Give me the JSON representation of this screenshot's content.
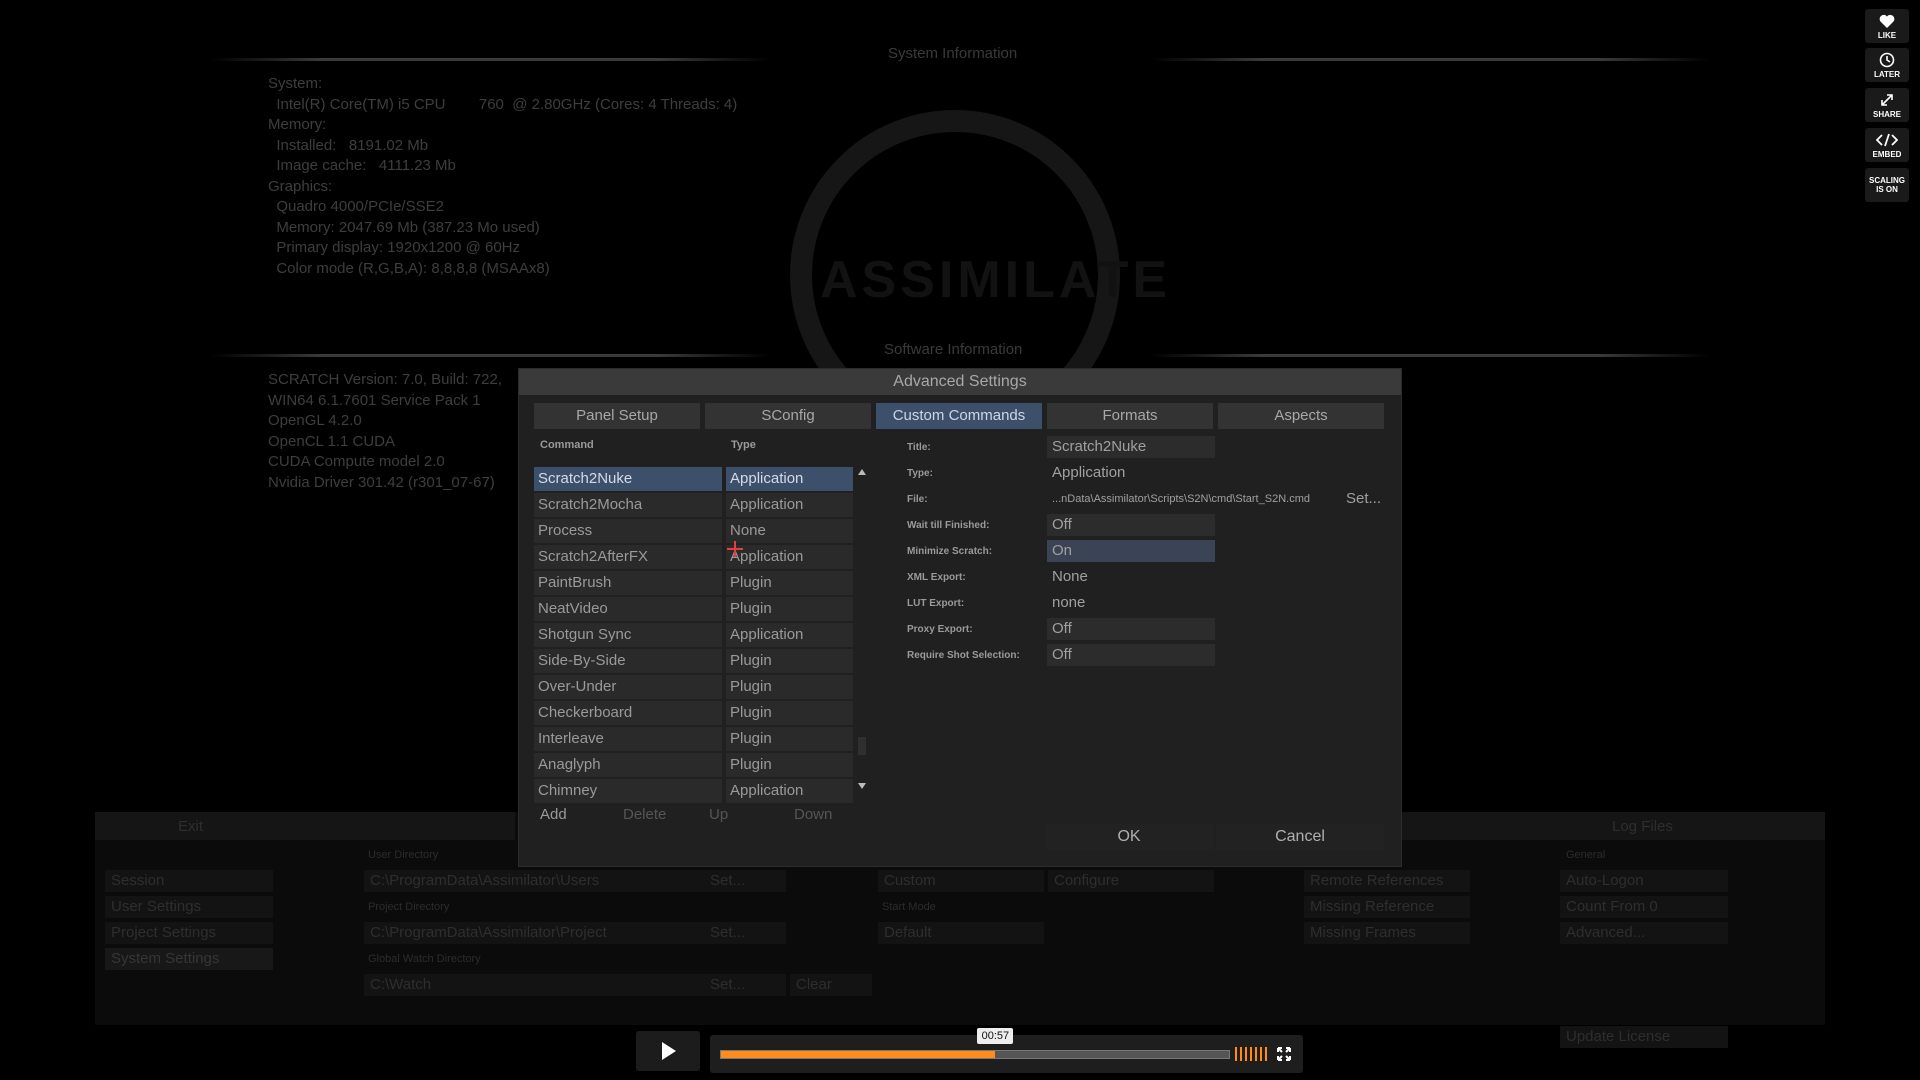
{
  "background": {
    "system_title": "System Information",
    "system_lines": [
      "System:",
      "  Intel(R) Core(TM) i5 CPU        760  @ 2.80GHz (Cores: 4 Threads: 4)",
      "Memory:",
      "  Installed:   8191.02 Mb",
      "  Image cache:   4111.23 Mb",
      "Graphics:",
      "  Quadro 4000/PCIe/SSE2",
      "  Memory: 2047.69 Mb (387.23 Mo used)",
      "  Primary display: 1920x1200 @ 60Hz",
      "  Color mode (R,G,B,A): 8,8,8,8 (MSAAx8)"
    ],
    "software_title": "Software Information",
    "software_lines": [
      "SCRATCH Version: 7.0, Build: 722,",
      "WIN64 6.1.7601 Service Pack 1",
      "OpenGL 4.2.0",
      "OpenCL 1.1 CUDA",
      "CUDA Compute model 2.0",
      "Nvidia Driver 301.42 (r301_07-67)"
    ],
    "logo": "ASSIMILATE",
    "bottom_left_header": "Exit",
    "bottom_right_header": "Log Files",
    "sidebar_items": [
      "Session",
      "User Settings",
      "Project Settings",
      "System Settings"
    ],
    "dir_labels": [
      "User Directory",
      "Project Directory",
      "Global Watch Directory"
    ],
    "dir_values": [
      "C:\\ProgramData\\Assimilator\\Users",
      "C:\\ProgramData\\Assimilator\\Project",
      "C:\\Watch"
    ],
    "set_label": "Set...",
    "clear_label": "Clear",
    "middle_buttons": [
      "Custom",
      "Configure"
    ],
    "middle_label": "Start Mode",
    "middle_button2": "Default",
    "reference_buttons": [
      "Remote References",
      "Missing Reference",
      "Missing Frames"
    ],
    "general_label": "General",
    "general_buttons": [
      "Auto-Logon",
      "Count From 0",
      "Advanced..."
    ],
    "update_license": "Update License"
  },
  "dialog": {
    "title": "Advanced Settings",
    "tabs": [
      "Panel Setup",
      "SConfig",
      "Custom Commands",
      "Formats",
      "Aspects"
    ],
    "active_tab": "Custom Commands",
    "col_command": "Command",
    "col_type": "Type",
    "commands": [
      {
        "name": "Scratch2Nuke",
        "type": "Application"
      },
      {
        "name": "Scratch2Mocha",
        "type": "Application"
      },
      {
        "name": "Process",
        "type": "None"
      },
      {
        "name": "Scratch2AfterFX",
        "type": "Application"
      },
      {
        "name": "PaintBrush",
        "type": "Plugin"
      },
      {
        "name": "NeatVideo",
        "type": "Plugin"
      },
      {
        "name": "Shotgun Sync",
        "type": "Application"
      },
      {
        "name": "Side-By-Side",
        "type": "Plugin"
      },
      {
        "name": "Over-Under",
        "type": "Plugin"
      },
      {
        "name": "Checkerboard",
        "type": "Plugin"
      },
      {
        "name": "Interleave",
        "type": "Plugin"
      },
      {
        "name": "Anaglyph",
        "type": "Plugin"
      },
      {
        "name": "Chimney",
        "type": "Application"
      }
    ],
    "list_buttons": {
      "add": "Add",
      "delete": "Delete",
      "up": "Up",
      "down": "Down"
    },
    "props": {
      "title_label": "Title:",
      "title_value": "Scratch2Nuke",
      "type_label": "Type:",
      "type_value": "Application",
      "file_label": "File:",
      "file_value": "...nData\\Assimilator\\Scripts\\S2N\\cmd\\Start_S2N.cmd",
      "file_set": "Set...",
      "wait_label": "Wait till Finished:",
      "wait_value": "Off",
      "minimize_label": "Minimize Scratch:",
      "minimize_value": "On",
      "xml_label": "XML Export:",
      "xml_value": "None",
      "lut_label": "LUT Export:",
      "lut_value": "none",
      "proxy_label": "Proxy Export:",
      "proxy_value": "Off",
      "require_label": "Require Shot Selection:",
      "require_value": "Off"
    },
    "ok": "OK",
    "cancel": "Cancel"
  },
  "player": {
    "time": "00:57",
    "progress": 0.54,
    "side_buttons": [
      "LIKE",
      "LATER",
      "SHARE",
      "EMBED",
      "SCALING IS ON"
    ]
  },
  "colors": {
    "accent": "#ff8c1a",
    "selection": "#3c4f6b"
  }
}
